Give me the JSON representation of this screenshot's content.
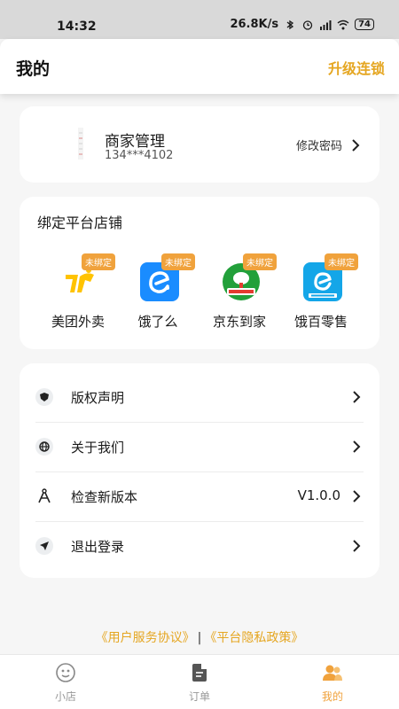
{
  "status_bar": {
    "time": "14:32",
    "network_speed": "26.8K/s",
    "battery": "74"
  },
  "header": {
    "title": "我的",
    "action": "升级连锁"
  },
  "merchant": {
    "name": "商家管理",
    "phone": "134***4102",
    "change_password": "修改密码"
  },
  "platforms": {
    "title": "绑定平台店铺",
    "items": [
      {
        "label": "美团外卖",
        "badge": "未绑定",
        "icon": "meituan-logo-icon"
      },
      {
        "label": "饿了么",
        "badge": "未绑定",
        "icon": "eleme-logo-icon"
      },
      {
        "label": "京东到家",
        "badge": "未绑定",
        "icon": "jd-daojia-logo-icon"
      },
      {
        "label": "饿百零售",
        "badge": "未绑定",
        "icon": "ebai-retail-logo-icon"
      }
    ]
  },
  "menu": {
    "items": [
      {
        "label": "版权声明",
        "icon": "shield-icon",
        "value": ""
      },
      {
        "label": "关于我们",
        "icon": "globe-icon",
        "value": ""
      },
      {
        "label": "检查新版本",
        "icon": "compass-icon",
        "value": "V1.0.0"
      },
      {
        "label": "退出登录",
        "icon": "send-icon",
        "value": ""
      }
    ]
  },
  "agreements": {
    "user_agreement": "《用户服务协议》",
    "separator": "|",
    "privacy_policy": "《平台隐私政策》"
  },
  "tabbar": {
    "items": [
      {
        "label": "小店",
        "icon": "store-icon",
        "active": false
      },
      {
        "label": "订单",
        "icon": "order-icon",
        "active": false
      },
      {
        "label": "我的",
        "icon": "user-icon",
        "active": true
      }
    ]
  },
  "colors": {
    "accent": "#e5a621",
    "badge": "#f0a23c",
    "background": "#f6f6f6"
  }
}
